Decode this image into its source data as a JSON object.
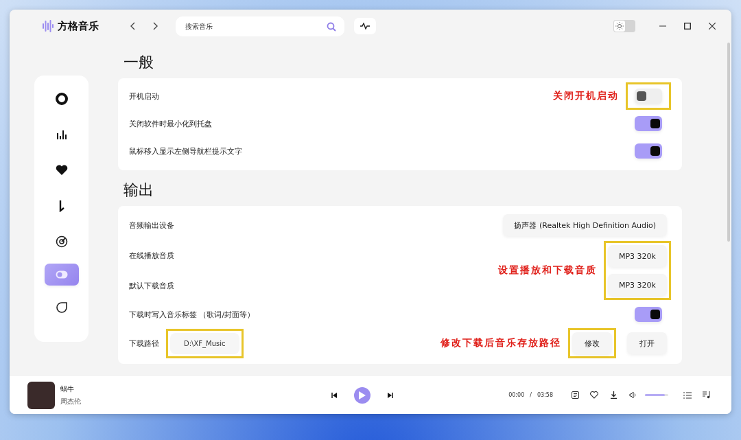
{
  "app": {
    "name": "方格音乐"
  },
  "search": {
    "placeholder": "搜索音乐"
  },
  "theme_toggle": {
    "on": false
  },
  "sidebar": {
    "items": [
      {
        "kind": "disc",
        "selected": false
      },
      {
        "kind": "bars",
        "selected": false
      },
      {
        "kind": "heart",
        "selected": false
      },
      {
        "kind": "note",
        "selected": false
      },
      {
        "kind": "gauge",
        "selected": false
      },
      {
        "kind": "toggle",
        "selected": true
      },
      {
        "kind": "leaf",
        "selected": false
      }
    ]
  },
  "sections": [
    {
      "title": "一般",
      "rows": [
        {
          "kind": "toggle",
          "label": "开机启动",
          "on": false,
          "highlighted": true,
          "note": "关闭开机启动"
        },
        {
          "kind": "toggle",
          "label": "关闭软件时最小化到托盘",
          "on": true,
          "highlighted": false
        },
        {
          "kind": "toggle",
          "label": "鼠标移入显示左侧导航栏提示文字",
          "on": true,
          "highlighted": false
        }
      ]
    },
    {
      "title": "输出",
      "rows": [
        {
          "kind": "select",
          "label": "音频输出设备",
          "value": "扬声器 (Realtek High Definition Audio)",
          "highlighted": false
        },
        {
          "kind": "group",
          "highlighted": true,
          "note": "设置播放和下载音质",
          "rows": [
            {
              "label": "在线播放音质",
              "value": "MP3 320k"
            },
            {
              "label": "默认下载音质",
              "value": "MP3 320k"
            }
          ]
        },
        {
          "kind": "toggle",
          "label": "下载时写入音乐标签 （歌词/封面等）",
          "on": true,
          "highlighted": false
        },
        {
          "kind": "path",
          "label": "下载路径",
          "value": "D:\\XF_Music",
          "highlighted": true,
          "note": "修改下载后音乐存放路径",
          "buttons": [
            {
              "label": "修改",
              "highlighted": true
            },
            {
              "label": "打开",
              "highlighted": false
            }
          ]
        }
      ]
    }
  ],
  "player": {
    "title": "蜗牛",
    "artist": "周杰伦",
    "elapsed": "00:00",
    "separator": "/",
    "duration": "03:58",
    "playing": false,
    "volume": {
      "level": 0.85
    }
  }
}
